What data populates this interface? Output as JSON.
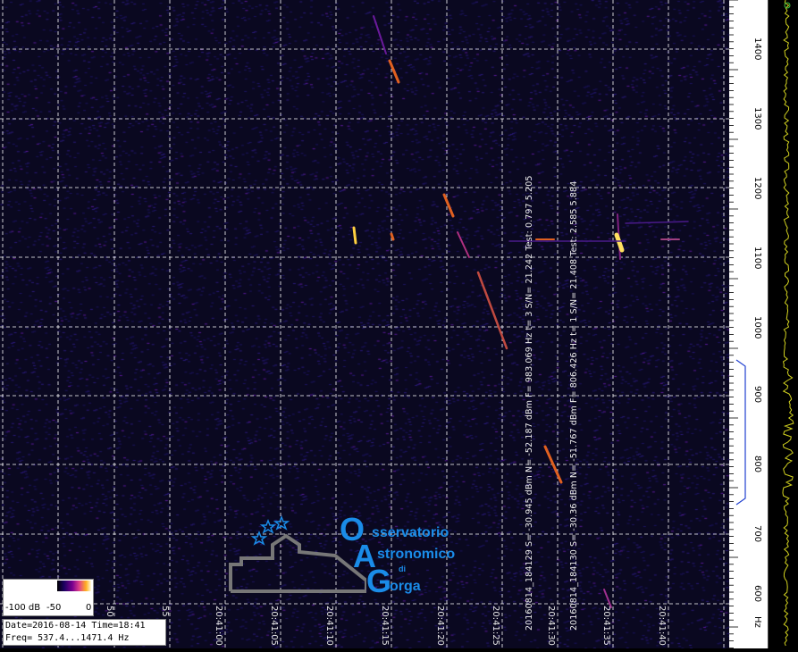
{
  "scale": {
    "db_min": "-100 dB",
    "db_mid": "-50",
    "db_max": "0"
  },
  "info": {
    "line1": "Date=2016-08-14 Time=18:41",
    "line2": "Freq= 537.4...1471.4 Hz"
  },
  "time_labels": [
    "50",
    "55",
    "20:41:00",
    "20:41:05",
    "20:41:10",
    "20:41:15",
    "20:41:20",
    "20:41:25",
    "20:41:30",
    "20:41:35",
    "20:41:40"
  ],
  "freq_labels": [
    "1400",
    "1300",
    "1200",
    "1100",
    "1000",
    "900",
    "800",
    "700",
    "600",
    "Hz"
  ],
  "annotations": [
    "20160814_184129 S= -30.945 dBm N= -52.187 dBm F= 983.069 Hz t= 3  S/N= 21.242 Test: 0.797 5.205",
    "20160814_184130 S= -30.36 dBm N= -51.767 dBm F= 806.426 Hz t= 1  S/N= 21.408 Test: 2.585 5.884"
  ],
  "logo": {
    "o_letter": "O",
    "o_word": "sservatorio",
    "a_letter": "A",
    "a_word": "stronomico",
    "di": "di",
    "g_letter": "G",
    "g_word": "orga",
    "accent_color": "#1a8ce8"
  },
  "colors": {
    "background": "#0a0820",
    "grid": "#ffffff",
    "trace": "#d4d420"
  }
}
